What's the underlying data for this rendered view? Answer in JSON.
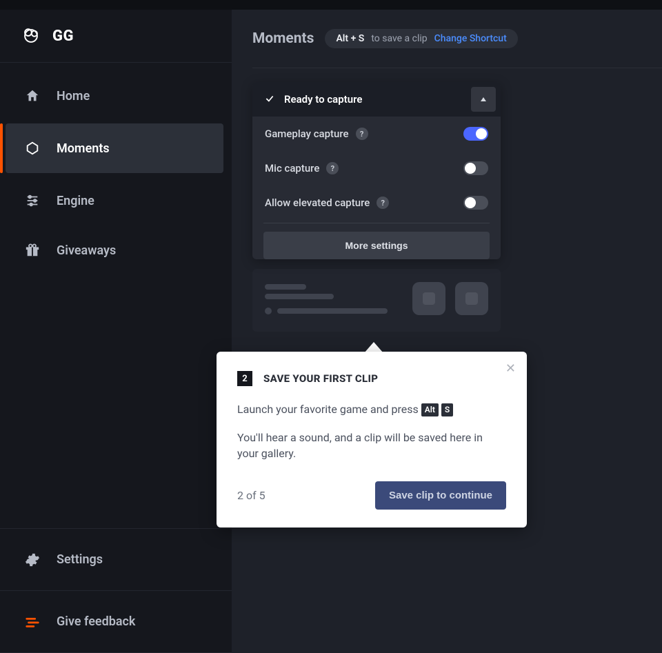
{
  "brand": {
    "name": "GG"
  },
  "sidebar": {
    "items": [
      {
        "label": "Home"
      },
      {
        "label": "Moments"
      },
      {
        "label": "Engine"
      },
      {
        "label": "Giveaways"
      }
    ],
    "bottom": [
      {
        "label": "Settings"
      },
      {
        "label": "Give feedback"
      }
    ]
  },
  "header": {
    "title": "Moments",
    "shortcut_keys": "Alt + S",
    "shortcut_text": "to save a clip",
    "change_link": "Change Shortcut"
  },
  "capture": {
    "status": "Ready to capture",
    "rows": [
      {
        "label": "Gameplay capture",
        "on": true
      },
      {
        "label": "Mic capture",
        "on": false
      },
      {
        "label": "Allow elevated capture",
        "on": false
      }
    ],
    "more": "More settings",
    "help_symbol": "?"
  },
  "tour": {
    "step_number": "2",
    "title": "SAVE YOUR FIRST CLIP",
    "line1_prefix": "Launch your favorite game and press ",
    "key1": "Alt",
    "key2": "S",
    "line2": "You'll hear a sound, and a clip will be saved here in your gallery.",
    "progress": "2 of 5",
    "cta": "Save clip to continue"
  }
}
